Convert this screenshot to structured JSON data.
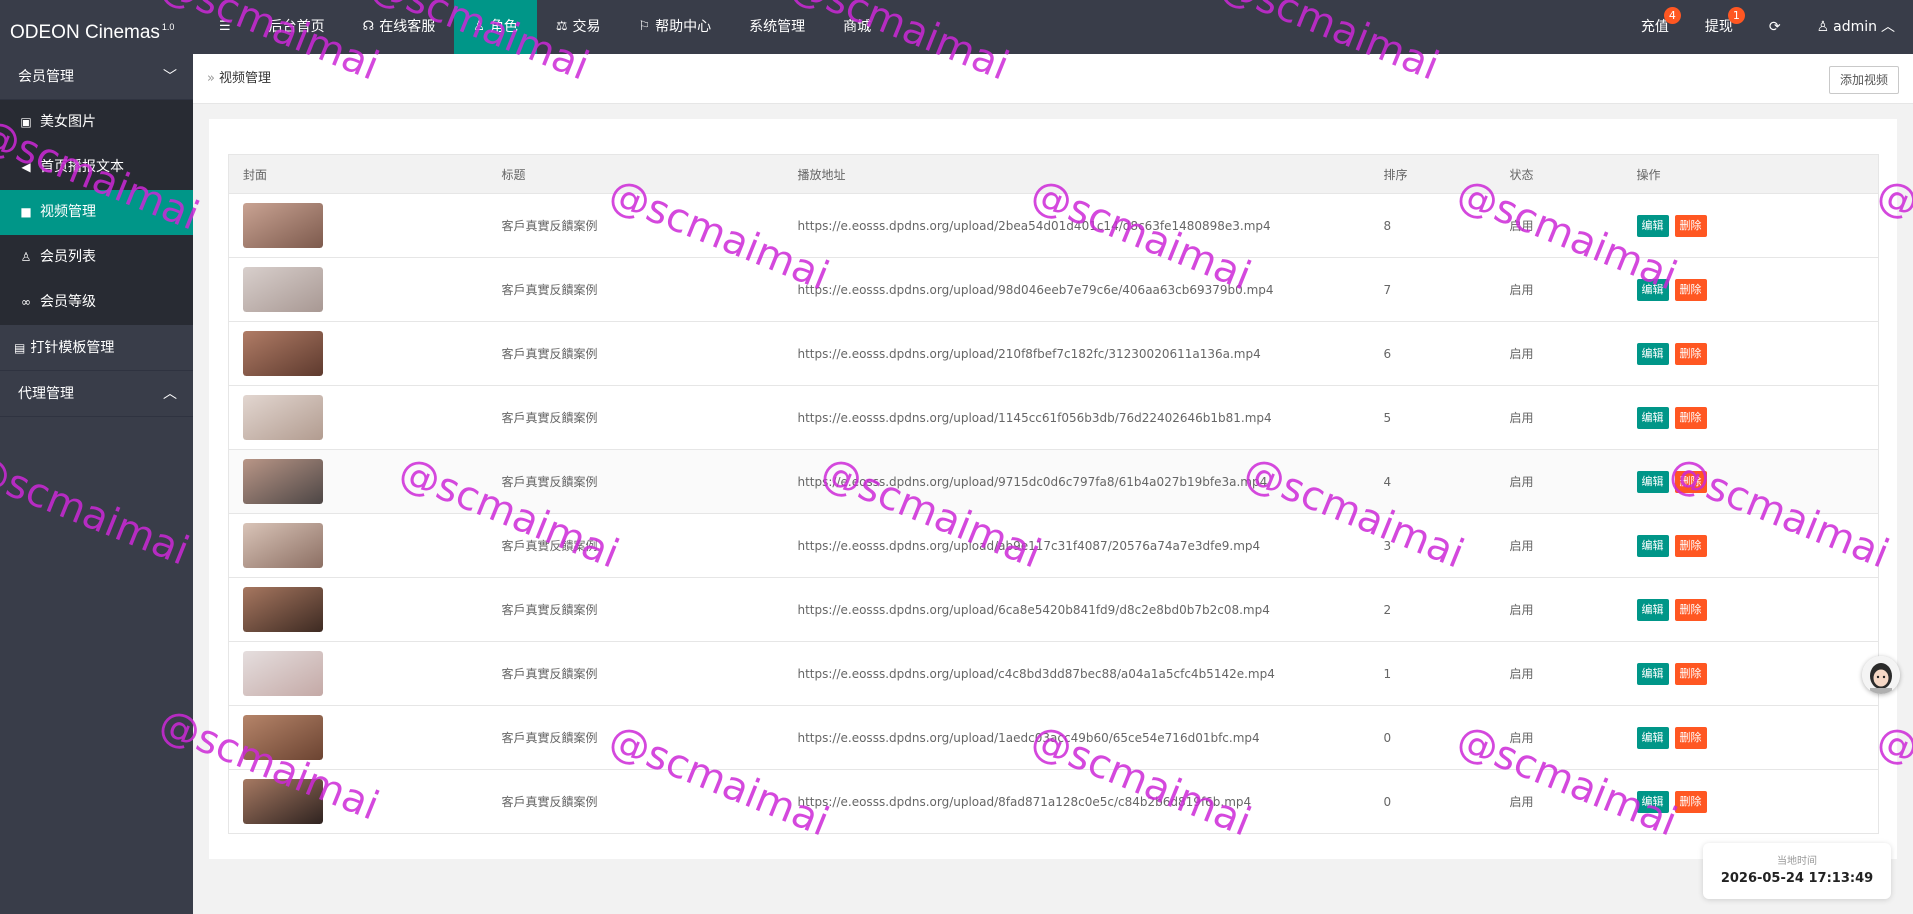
{
  "app": {
    "name": "ODEON Cinemas",
    "version": "1.0"
  },
  "topnav": {
    "items": [
      {
        "label": "后台首页"
      },
      {
        "label": "在线客服"
      },
      {
        "label": "角色"
      },
      {
        "label": "交易"
      },
      {
        "label": "帮助中心"
      },
      {
        "label": "系统管理"
      },
      {
        "label": "商城"
      }
    ],
    "active_index": 2,
    "recharge_label": "充值",
    "recharge_badge": "4",
    "withdraw_label": "提现",
    "withdraw_badge": "1",
    "user_label": "admin"
  },
  "sidebar": {
    "group_member": "会员管理",
    "items": [
      {
        "label": "美女图片",
        "icon": "image-icon"
      },
      {
        "label": "首页播报文本",
        "icon": "megaphone-icon"
      },
      {
        "label": "视频管理",
        "icon": "video-icon"
      },
      {
        "label": "会员列表",
        "icon": "user-icon"
      },
      {
        "label": "会员等级",
        "icon": "link-icon"
      }
    ],
    "active_item": "视频管理",
    "group_template": "打针模板管理",
    "group_agent": "代理管理"
  },
  "breadcrumb": {
    "current": "视频管理",
    "add_button": "添加视频"
  },
  "table": {
    "columns": [
      "封面",
      "标题",
      "播放地址",
      "排序",
      "状态",
      "操作"
    ],
    "edit_label": "编辑",
    "delete_label": "删除",
    "rows": [
      {
        "title": "客戶真實反饋案例",
        "url": "https://e.eosss.dpdns.org/upload/2bea54d01d401c14/d8c63fe1480898e3.mp4",
        "sort": "8",
        "status": "启用"
      },
      {
        "title": "客戶真實反饋案例",
        "url": "https://e.eosss.dpdns.org/upload/98d046eeb7e79c6e/406aa63cb69379b0.mp4",
        "sort": "7",
        "status": "启用"
      },
      {
        "title": "客戶真實反饋案例",
        "url": "https://e.eosss.dpdns.org/upload/210f8fbef7c182fc/31230020611a136a.mp4",
        "sort": "6",
        "status": "启用"
      },
      {
        "title": "客戶真實反饋案例",
        "url": "https://e.eosss.dpdns.org/upload/1145cc61f056b3db/76d22402646b1b81.mp4",
        "sort": "5",
        "status": "启用"
      },
      {
        "title": "客戶真實反饋案例",
        "url": "https://e.eosss.dpdns.org/upload/9715dc0d6c797fa8/61b4a027b19bfe3a.mp4",
        "sort": "4",
        "status": "启用"
      },
      {
        "title": "客戶真實反饋案例",
        "url": "https://e.eosss.dpdns.org/upload/ab9e117c31f4087/20576a74a7e3dfe9.mp4",
        "sort": "3",
        "status": "启用"
      },
      {
        "title": "客戶真實反饋案例",
        "url": "https://e.eosss.dpdns.org/upload/6ca8e5420b841fd9/d8c2e8bd0b7b2c08.mp4",
        "sort": "2",
        "status": "启用"
      },
      {
        "title": "客戶真實反饋案例",
        "url": "https://e.eosss.dpdns.org/upload/c4c8bd3dd87bec88/a04a1a5cfc4b5142e.mp4",
        "sort": "1",
        "status": "启用"
      },
      {
        "title": "客戶真實反饋案例",
        "url": "https://e.eosss.dpdns.org/upload/1aedc03acc49b60/65ce54e716d01bfc.mp4",
        "sort": "0",
        "status": "启用"
      },
      {
        "title": "客戶真實反饋案例",
        "url": "https://e.eosss.dpdns.org/upload/8fad871a128c0e5c/c84b2b6d819f6b.mp4",
        "sort": "0",
        "status": "启用"
      }
    ]
  },
  "clock": {
    "label": "当地时间",
    "value": "2026-05-24 17:13:49"
  },
  "watermark": "@scmaimai",
  "colors": {
    "header_bg": "#393d49",
    "accent": "#009688",
    "danger": "#ff5722",
    "watermark": "#cd28d7"
  }
}
